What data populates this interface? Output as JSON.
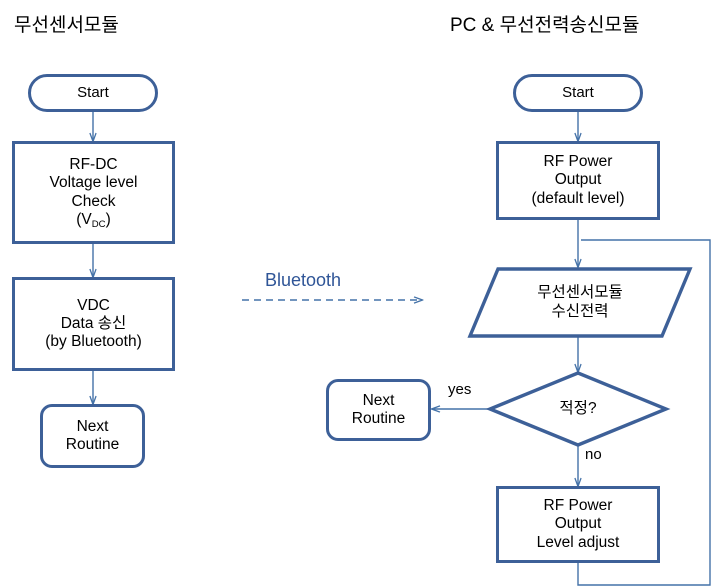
{
  "diagram": {
    "type": "flowchart",
    "columns": [
      {
        "id": "left",
        "title": "무선센서모듈"
      },
      {
        "id": "right",
        "title": "PC & 무선전력송신모듈"
      }
    ],
    "colors": {
      "shape_border": "#3d6098",
      "connector": "#4472a8",
      "bluetooth_label": "#2f5597",
      "background": "#ffffff",
      "text": "#000000"
    },
    "left_column": {
      "nodes": [
        {
          "id": "l-start",
          "shape": "terminal",
          "label": "Start"
        },
        {
          "id": "l-rfdc",
          "shape": "process",
          "line1": "RF-DC",
          "line2": "Voltage level",
          "line3": "Check",
          "line4_pre": "(V",
          "line4_sub": "DC",
          "line4_post": ")"
        },
        {
          "id": "l-vdc",
          "shape": "process",
          "label": "VDC\nData 송신\n(by Bluetooth)"
        },
        {
          "id": "l-next",
          "shape": "rounded",
          "label": "Next\nRoutine"
        }
      ]
    },
    "right_column": {
      "nodes": [
        {
          "id": "r-start",
          "shape": "terminal",
          "label": "Start"
        },
        {
          "id": "r-rfpower",
          "shape": "process",
          "label": "RF Power\nOutput\n(default level)"
        },
        {
          "id": "r-recv",
          "shape": "parallelogram",
          "label": "무선센서모듈\n수신전력"
        },
        {
          "id": "r-decision",
          "shape": "diamond",
          "label": "적정?"
        },
        {
          "id": "r-next",
          "shape": "rounded",
          "label": "Next\nRoutine"
        },
        {
          "id": "r-adjust",
          "shape": "process",
          "label": "RF Power\nOutput\nLevel adjust"
        }
      ]
    },
    "edge_labels": {
      "yes": "yes",
      "no": "no",
      "bluetooth": "Bluetooth"
    }
  }
}
